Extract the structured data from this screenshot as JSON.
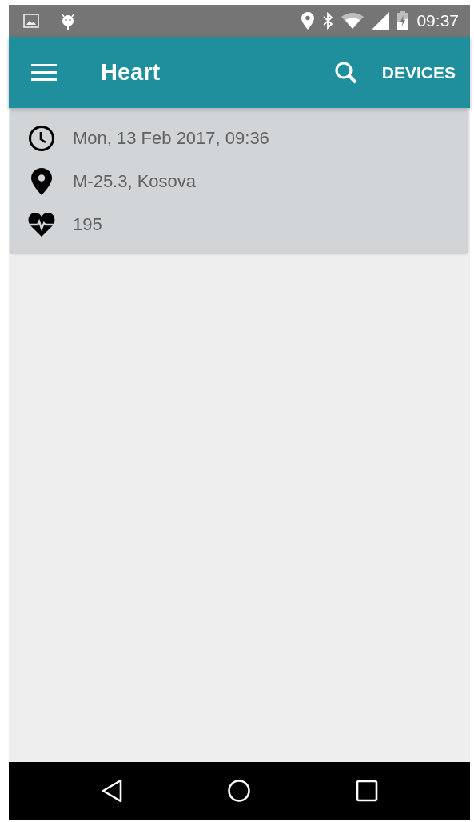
{
  "status_bar": {
    "time": "09:37"
  },
  "app_bar": {
    "title": "Heart",
    "action": "DEVICES"
  },
  "card": {
    "rows": [
      {
        "kind": "time",
        "text": "Mon, 13 Feb 2017, 09:36"
      },
      {
        "kind": "location",
        "text": "M-25.3, Kosova"
      },
      {
        "kind": "heart_rate",
        "text": "195"
      }
    ]
  }
}
